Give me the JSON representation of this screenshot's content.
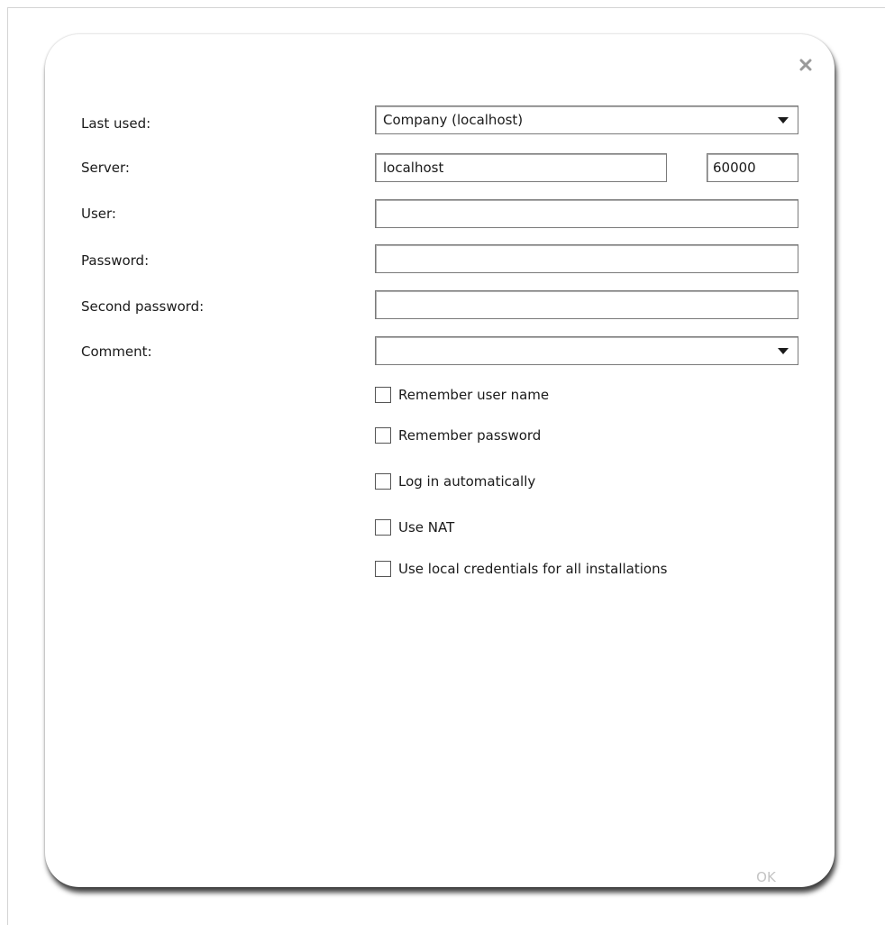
{
  "form": {
    "last_used": {
      "label": "Last used:",
      "value": "Company (localhost)"
    },
    "server": {
      "label": "Server:",
      "host": "localhost",
      "port": "60000"
    },
    "user": {
      "label": "User:",
      "value": ""
    },
    "password": {
      "label": "Password:",
      "value": ""
    },
    "second_password": {
      "label": "Second password:",
      "value": ""
    },
    "comment": {
      "label": "Comment:",
      "value": ""
    }
  },
  "options": [
    {
      "label": "Remember user name",
      "checked": false
    },
    {
      "label": "Remember password",
      "checked": false
    },
    {
      "label": "Log in automatically",
      "checked": false
    },
    {
      "label": "Use NAT",
      "checked": false
    },
    {
      "label": "Use local credentials for all installations",
      "checked": false
    }
  ],
  "buttons": {
    "ok_label": "OK",
    "close_icon": "close-icon"
  },
  "colors": {
    "disabled_text": "#c4c4c4",
    "close_icon": "#9a9a9a"
  }
}
